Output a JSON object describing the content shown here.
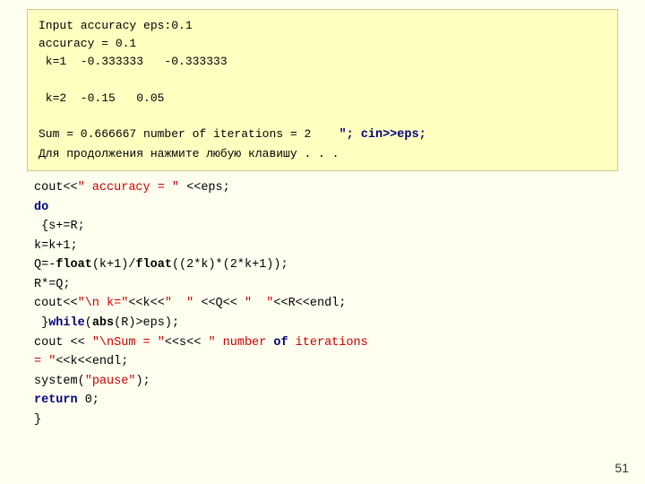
{
  "slide": {
    "slide_number": "51",
    "output_box": {
      "lines": [
        "Input accuracy eps:0.1",
        "accuracy = 0.1",
        " k=1  -0.333333   -0.333333",
        "",
        " k=2  -0.15   0.05",
        "",
        "Sum = 0.666667 number of iterations = 2"
      ],
      "inline_code": "\"; cin>>eps;",
      "continuation": "Для продолжения нажмите любую клавишу . . ."
    },
    "code": {
      "lines": [
        {
          "id": 1,
          "text": "cout<< accuracy = <<eps;",
          "type": "mixed"
        },
        {
          "id": 2,
          "text": "do",
          "type": "keyword"
        },
        {
          "id": 3,
          "text": " {s+=R;",
          "type": "plain"
        },
        {
          "id": 4,
          "text": "k=k+1;",
          "type": "plain"
        },
        {
          "id": 5,
          "text": "Q=-float(k+1)/float((2*k)*(2*k+1));",
          "type": "mixed"
        },
        {
          "id": 6,
          "text": "R*=Q;",
          "type": "plain"
        },
        {
          "id": 7,
          "text": "cout<<\"\\n k=\"<<k<<\"  \" <<Q<< \"  \"<<R<<endl;",
          "type": "mixed"
        },
        {
          "id": 8,
          "text": "}while(abs(R)>eps);",
          "type": "mixed"
        },
        {
          "id": 9,
          "text": "cout << \"\\nSum = \"<<s<< \" number of iterations",
          "type": "mixed"
        },
        {
          "id": 10,
          "text": " = \"<<k<<endl;",
          "type": "mixed"
        },
        {
          "id": 11,
          "text": "system(\"pause\");",
          "type": "mixed"
        },
        {
          "id": 12,
          "text": "return 0;",
          "type": "mixed"
        },
        {
          "id": 13,
          "text": "}",
          "type": "plain"
        }
      ]
    }
  }
}
